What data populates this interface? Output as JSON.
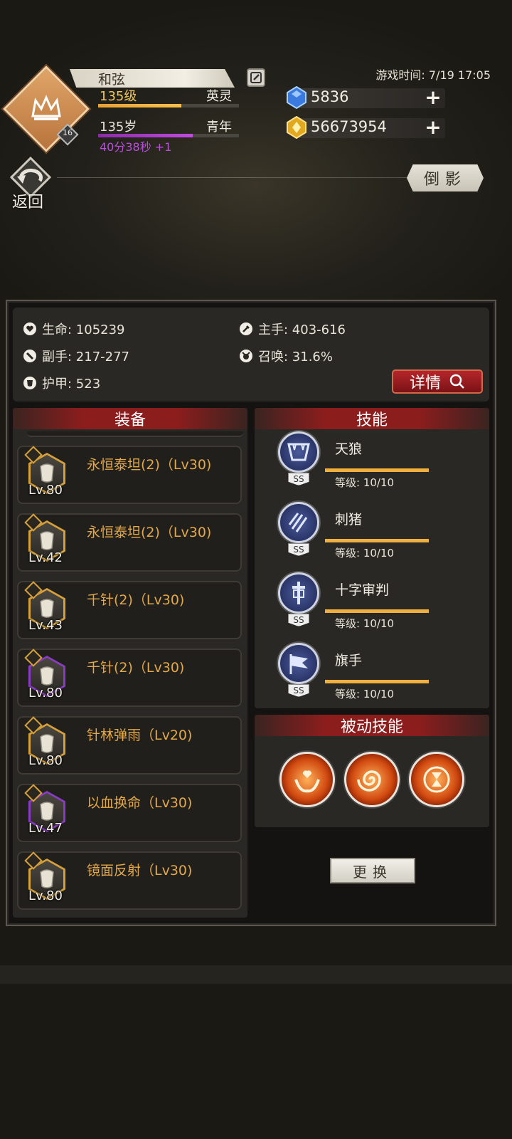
{
  "header": {
    "name": "和弦",
    "level": "135级",
    "title": "英灵",
    "level_progress": 0.59,
    "age": "135岁",
    "age_stage": "青年",
    "age_progress": 0.67,
    "timer": "40分38秒 +1",
    "rank_badge": "16",
    "game_time": "游戏时间: 7/19 17:05",
    "gems": "5836",
    "gold": "56673954",
    "back_label": "返回",
    "reflection_label": "倒影"
  },
  "stats": {
    "hp": "生命: 105239",
    "main_hand": "主手: 403-616",
    "off_hand": "副手: 217-277",
    "summon": "召唤: 31.6%",
    "armor": "护甲: 523",
    "detail_label": "详情"
  },
  "equipment": {
    "header": "装备",
    "items": [
      {
        "name": "永恒泰坦(2)（Lv30)",
        "level": "Lv.80"
      },
      {
        "name": "永恒泰坦(2)（Lv30)",
        "level": "Lv.42"
      },
      {
        "name": "千针(2)（Lv30)",
        "level": "Lv.43"
      },
      {
        "name": "千针(2)（Lv30)",
        "level": "Lv.80"
      },
      {
        "name": "针林弹雨（Lv20)",
        "level": "Lv.80"
      },
      {
        "name": "以血换命（Lv30)",
        "level": "Lv.47"
      },
      {
        "name": "镜面反射（Lv30)",
        "level": "Lv.80"
      }
    ]
  },
  "skills": {
    "header": "技能",
    "items": [
      {
        "name": "天狼",
        "level": "等级: 10/10",
        "rank": "SS"
      },
      {
        "name": "刺猪",
        "level": "等级: 10/10",
        "rank": "SS"
      },
      {
        "name": "十字审判",
        "level": "等级: 10/10",
        "rank": "SS"
      },
      {
        "name": "旗手",
        "level": "等级: 10/10",
        "rank": "SS"
      }
    ]
  },
  "passive": {
    "header": "被动技能",
    "icons": [
      "heart-hands-icon",
      "spiral-icon",
      "hourglass-icon"
    ]
  },
  "swap_label": "更换",
  "colors": {
    "accent_gold": "#e3a84a",
    "header_red": "#8c1d1d",
    "skill_bar": "#f0b040",
    "timer_purple": "#b651d8"
  }
}
